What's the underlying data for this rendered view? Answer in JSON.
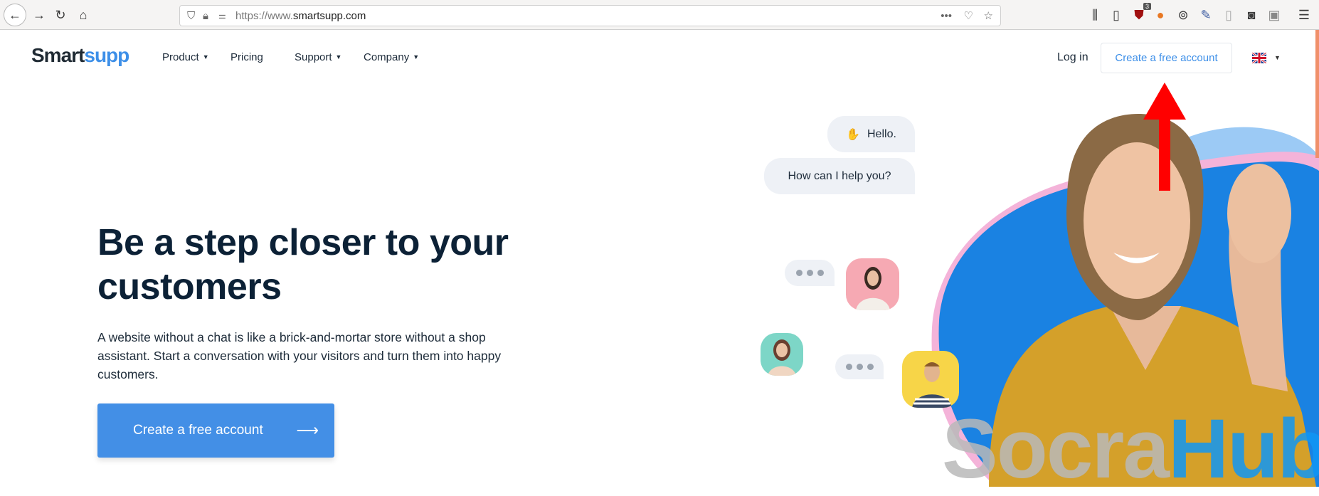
{
  "browser": {
    "url_prefix": "https://www.",
    "url_domain": "smartsupp.com",
    "badge_count": "3"
  },
  "nav": {
    "logo_main": "Smart",
    "logo_accent": "supp",
    "items": [
      {
        "label": "Product"
      },
      {
        "label": "Pricing"
      },
      {
        "label": "Support"
      },
      {
        "label": "Company"
      }
    ],
    "login": "Log in",
    "create_account": "Create a free account"
  },
  "hero": {
    "title": "Be a step closer to your customers",
    "description": "A website without a chat is like a brick-and-mortar store without a shop assistant. Start a conversation with your visitors and turn them into happy customers.",
    "cta": "Create a free account",
    "cta_arrow": "⟶"
  },
  "chat": {
    "hello": "Hello.",
    "help": "How can I help you?"
  },
  "watermark": {
    "part1": "Socra",
    "part2": "Hub"
  },
  "colors": {
    "brand": "#438fe6",
    "heading": "#0c2136",
    "annotation_arrow": "#ff0000"
  }
}
